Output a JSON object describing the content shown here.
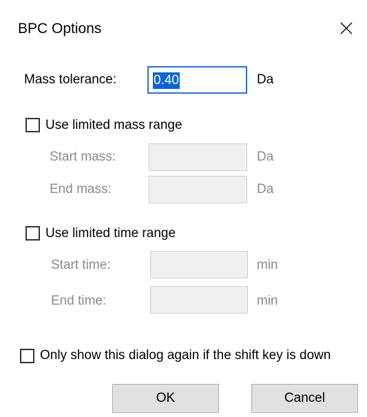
{
  "dialog": {
    "title": "BPC Options",
    "close_icon": "close-x-icon"
  },
  "mass_tolerance": {
    "label": "Mass tolerance:",
    "value": "0.40",
    "unit": "Da"
  },
  "limited_mass_range": {
    "checkbox_label": "Use limited mass range",
    "checked": false,
    "start_label": "Start mass:",
    "start_value": "",
    "start_unit": "Da",
    "end_label": "End mass:",
    "end_value": "",
    "end_unit": "Da"
  },
  "limited_time_range": {
    "checkbox_label": "Use limited time range",
    "checked": false,
    "start_label": "Start time:",
    "start_value": "",
    "start_unit": "min",
    "end_label": "End time:",
    "end_value": "",
    "end_unit": "min"
  },
  "shift_option": {
    "checkbox_label": "Only show this dialog again if the shift key is down",
    "checked": false
  },
  "buttons": {
    "ok": "OK",
    "cancel": "Cancel"
  },
  "colors": {
    "selection": "#0a64d8",
    "active_border": "#2c6fd0",
    "disabled_text": "#8a8a8a"
  }
}
